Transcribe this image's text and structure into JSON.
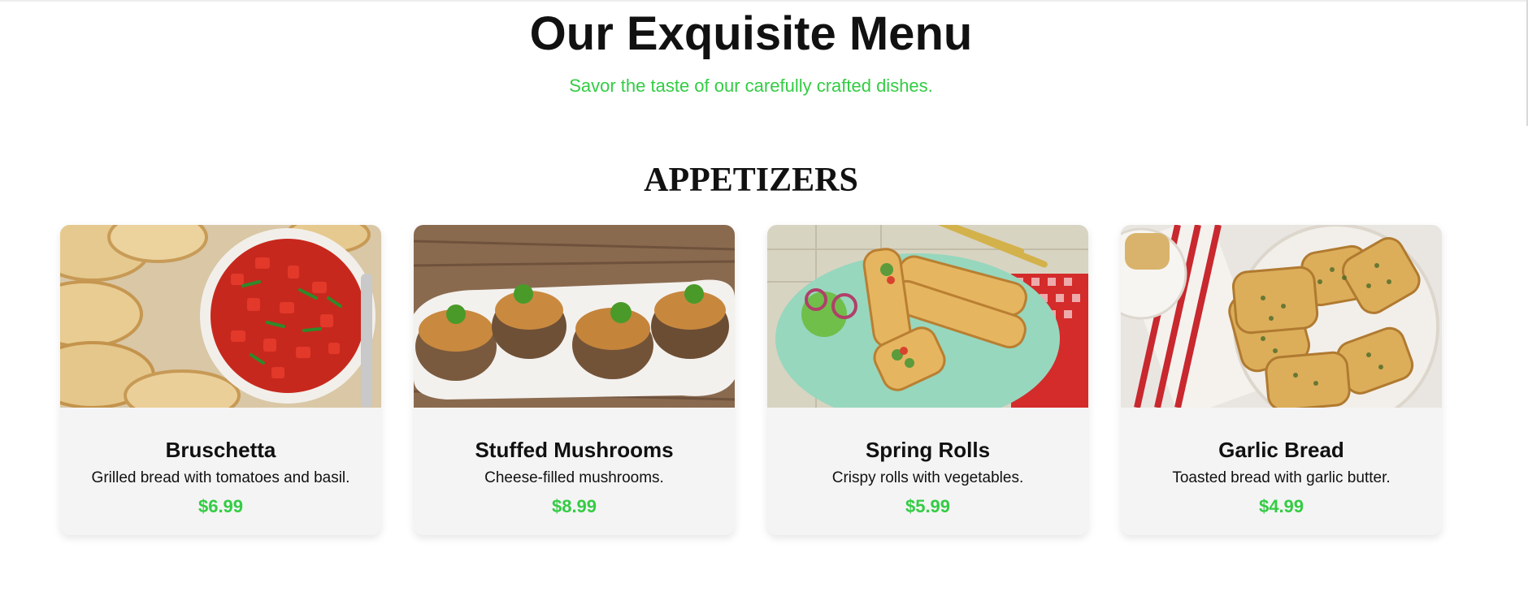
{
  "header": {
    "title": "Our Exquisite Menu",
    "subtitle": "Savor the taste of our carefully crafted dishes."
  },
  "section": {
    "title": "APPETIZERS"
  },
  "colors": {
    "accent": "#33cc44",
    "card_bg": "#f4f4f4",
    "text": "#111111"
  },
  "items": [
    {
      "name": "Bruschetta",
      "description": "Grilled bread with tomatoes and basil.",
      "price": "$6.99",
      "image": "bruschetta-photo"
    },
    {
      "name": "Stuffed Mushrooms",
      "description": "Cheese-filled mushrooms.",
      "price": "$8.99",
      "image": "stuffed-mushrooms-photo"
    },
    {
      "name": "Spring Rolls",
      "description": "Crispy rolls with vegetables.",
      "price": "$5.99",
      "image": "spring-rolls-photo"
    },
    {
      "name": "Garlic Bread",
      "description": "Toasted bread with garlic butter.",
      "price": "$4.99",
      "image": "garlic-bread-photo"
    }
  ]
}
